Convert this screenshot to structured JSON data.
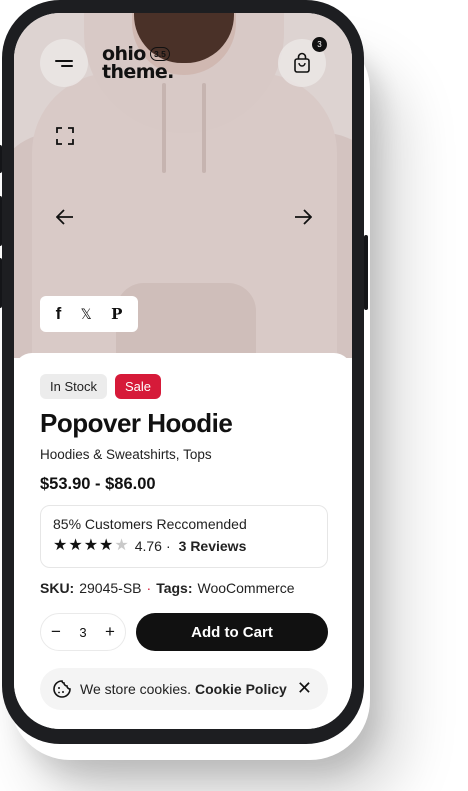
{
  "header": {
    "logo_line1": "ohio",
    "logo_line2": "theme.",
    "logo_version": "3.5",
    "cart_count": "3"
  },
  "product": {
    "badges": {
      "stock": "In Stock",
      "sale": "Sale"
    },
    "title": "Popover Hoodie",
    "categories": "Hoodies & Sweatshirts, Tops",
    "price": "$53.90 - $86.00",
    "recommend_text": "85% Customers Reccomended",
    "rating": {
      "value": "4.76",
      "separator": "·",
      "reviews": "3 Reviews",
      "stars_filled": 4,
      "stars_total": 5
    },
    "sku_label": "SKU:",
    "sku": "29045-SB",
    "meta_separator": "·",
    "tags_label": "Tags:",
    "tags": "WooCommerce"
  },
  "cart": {
    "minus": "−",
    "quantity": "3",
    "plus": "+",
    "add_label": "Add to Cart"
  },
  "cookie": {
    "text": "We store cookies.",
    "link": "Cookie Policy",
    "close": "✕"
  },
  "share": {
    "facebook": "f",
    "x": "𝕏",
    "pinterest": "P"
  },
  "colors": {
    "sale": "#d61a39",
    "button": "#111111",
    "hoodie": "#d9cac7"
  }
}
